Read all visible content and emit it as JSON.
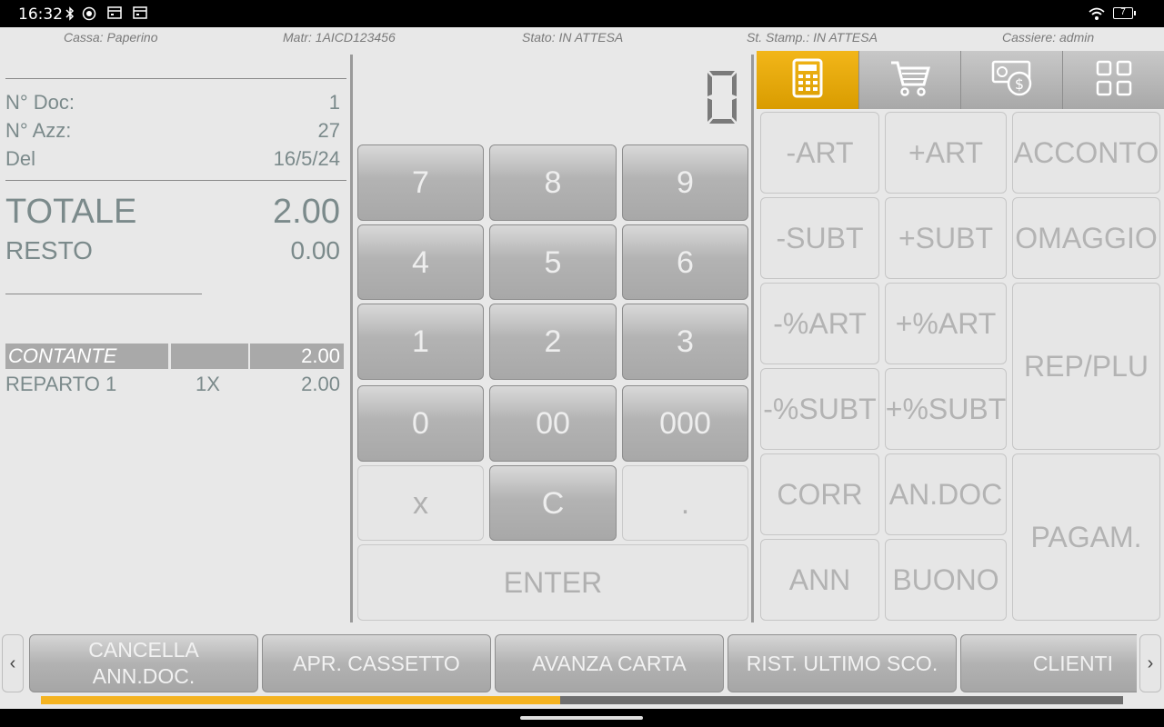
{
  "status_bar": {
    "time": "16:32",
    "battery": "7",
    "icons": [
      "bluetooth-icon",
      "nfc-icon",
      "calendar-icon",
      "calendar-icon",
      "wifi-icon",
      "battery-icon"
    ]
  },
  "info_bar": {
    "cassa": "Cassa: Paperino",
    "matr": "Matr: 1AICD123456",
    "stato": "Stato: IN ATTESA",
    "st_stamp": "St. Stamp.: IN ATTESA",
    "cassiere": "Cassiere: admin"
  },
  "receipt": {
    "n_doc_label": "N° Doc:",
    "n_doc_value": "1",
    "n_azz_label": "N° Azz:",
    "n_azz_value": "27",
    "del_label": "Del",
    "del_value": "16/5/24",
    "totale_label": "TOTALE",
    "totale_value": "2.00",
    "resto_label": "RESTO",
    "resto_value": "0.00",
    "payment": {
      "method": "CONTANTE",
      "middle": "",
      "amount": "2.00"
    },
    "items": [
      {
        "name": "REPARTO 1",
        "qty": "1X",
        "amount": "2.00"
      }
    ]
  },
  "display": {
    "value": "0"
  },
  "keypad": {
    "k7": "7",
    "k8": "8",
    "k9": "9",
    "k4": "4",
    "k5": "5",
    "k6": "6",
    "k1": "1",
    "k2": "2",
    "k3": "3",
    "k0": "0",
    "k00": "00",
    "k000": "000",
    "kx": "x",
    "kc": "C",
    "kdot": ".",
    "enter": "ENTER"
  },
  "tabs": [
    "calculator-icon",
    "cart-icon",
    "money-icon",
    "grid-icon"
  ],
  "functions": {
    "minus_art": "-ART",
    "plus_art": "+ART",
    "acconto": "ACCONTO",
    "minus_subt": "-SUBT",
    "plus_subt": "+SUBT",
    "omaggio": "OMAGGIO",
    "minus_pct_art": "-%ART",
    "plus_pct_art": "+%ART",
    "rep_plu": "REP/PLU",
    "minus_pct_subt": "-%SUBT",
    "plus_pct_subt": "+%SUBT",
    "corr": "CORR",
    "an_doc": "AN.DOC",
    "pagam": "PAGAM.",
    "ann": "ANN",
    "buono": "BUONO"
  },
  "shortcuts": {
    "prev": "‹",
    "next": "›",
    "cancella_line1": "CANCELLA",
    "cancella_line2": "ANN.DOC.",
    "apr_cassetto": "APR. CASSETTO",
    "avanza_carta": "AVANZA CARTA",
    "rist_ultimo": "RIST. ULTIMO SCO.",
    "clienti": "CLIENTI"
  },
  "scroll_progress": 0.48,
  "colors": {
    "accent": "#f2b619",
    "text_muted": "#7b8a8b",
    "key_dark": "#b3b3b3",
    "key_light": "#e6e6e6"
  }
}
